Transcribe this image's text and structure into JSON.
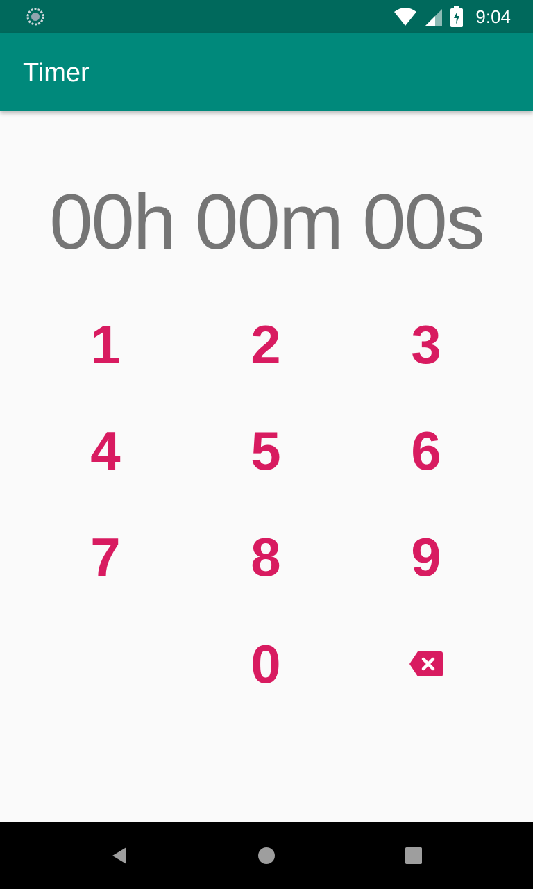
{
  "status_bar": {
    "time": "9:04",
    "icons": [
      "sync-icon",
      "wifi-icon",
      "cellular-signal-icon",
      "battery-charging-icon"
    ]
  },
  "app_bar": {
    "title": "Timer",
    "color": "#00897b"
  },
  "timer": {
    "display": "00h 00m 00s"
  },
  "keypad": {
    "accent_color": "#d81b60",
    "keys": [
      "1",
      "2",
      "3",
      "4",
      "5",
      "6",
      "7",
      "8",
      "9",
      "0"
    ],
    "delete_icon": "backspace-icon"
  },
  "nav_bar": {
    "icons": [
      "back-icon",
      "home-icon",
      "recents-icon"
    ]
  }
}
